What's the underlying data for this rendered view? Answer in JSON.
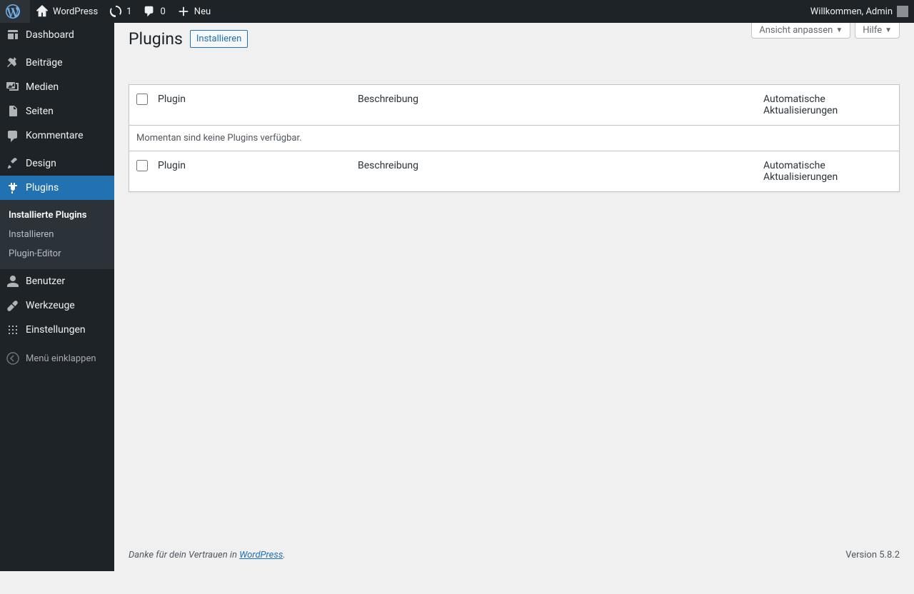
{
  "adminbar": {
    "site_name": "WordPress",
    "updates_count": "1",
    "comments_count": "0",
    "new_label": "Neu",
    "greeting": "Willkommen, Admin"
  },
  "sidebar": {
    "items": [
      {
        "label": "Dashboard"
      },
      {
        "label": "Beiträge"
      },
      {
        "label": "Medien"
      },
      {
        "label": "Seiten"
      },
      {
        "label": "Kommentare"
      },
      {
        "label": "Design"
      },
      {
        "label": "Plugins"
      },
      {
        "label": "Benutzer"
      },
      {
        "label": "Werkzeuge"
      },
      {
        "label": "Einstellungen"
      }
    ],
    "submenu": [
      {
        "label": "Installierte Plugins"
      },
      {
        "label": "Installieren"
      },
      {
        "label": "Plugin-Editor"
      }
    ],
    "collapse_label": "Menü einklappen"
  },
  "page": {
    "title": "Plugins",
    "install_button": "Installieren",
    "screen_options": "Ansicht anpassen",
    "help": "Hilfe"
  },
  "table": {
    "col_plugin": "Plugin",
    "col_description": "Beschreibung",
    "col_auto_updates": "Automatische Aktualisierungen",
    "empty_message": "Momentan sind keine Plugins verfügbar."
  },
  "footer": {
    "thanks_prefix": "Danke für dein Vertrauen in ",
    "thanks_link": "WordPress",
    "thanks_suffix": ".",
    "version": "Version 5.8.2"
  }
}
